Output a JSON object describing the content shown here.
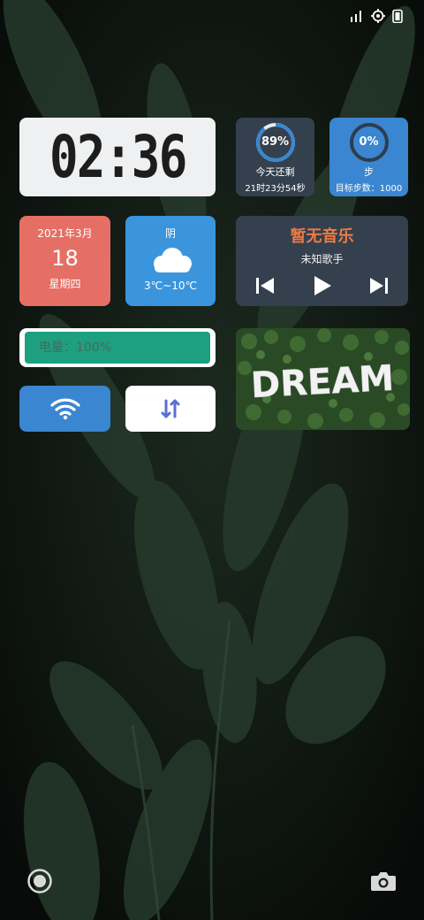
{
  "clock": {
    "time": "02:36"
  },
  "day_progress": {
    "percent": "89%",
    "value": 0.89,
    "label": "今天还剩",
    "remaining": "21时23分54秒",
    "bg_color": "#34404e",
    "ring_color": "#3a86d0"
  },
  "steps": {
    "percent": "0%",
    "value": 0.0,
    "label": "步",
    "goal": "目标步数：1000",
    "bg_color": "#3a86d0"
  },
  "date": {
    "year_month": "2021年3月",
    "day": "18",
    "weekday": "星期四",
    "bg_color": "#e56f64"
  },
  "weather": {
    "condition": "阴",
    "temperature": "3℃~10℃",
    "icon": "cloud-icon",
    "bg_color": "#3a95dd"
  },
  "music": {
    "title": "暂无音乐",
    "artist": "未知歌手",
    "title_color": "#ee7a44"
  },
  "battery": {
    "label": "电量：100%",
    "value": 1.0,
    "color": "#1da080"
  },
  "toggles": {
    "wifi_icon": "wifi-icon",
    "data_icon": "data-transfer-icon"
  },
  "photo": {
    "text": "DREAM"
  },
  "status_icons": [
    "signal-icon",
    "location-icon",
    "battery-icon"
  ],
  "bottom": {
    "left_icon": "circle-button-icon",
    "right_icon": "camera-icon"
  }
}
